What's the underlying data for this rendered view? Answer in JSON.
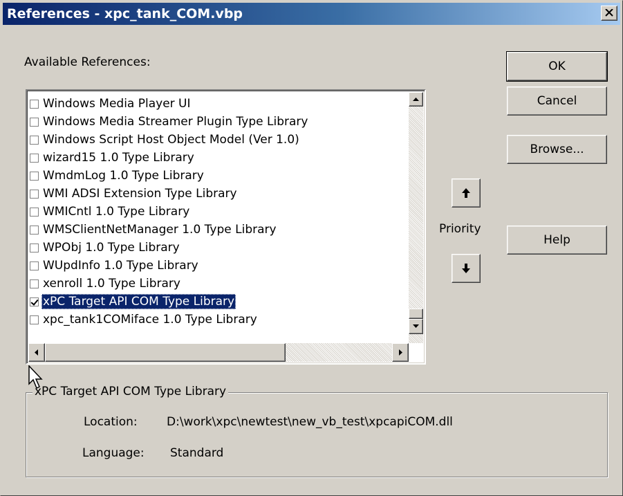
{
  "window": {
    "title": "References - xpc_tank_COM.vbp"
  },
  "available_label": "Available References:",
  "buttons": {
    "ok": "OK",
    "cancel": "Cancel",
    "browse": "Browse...",
    "help": "Help"
  },
  "priority_label": "Priority",
  "references": [
    {
      "label": "Windows Media Player UI",
      "checked": false
    },
    {
      "label": "Windows Media Streamer Plugin Type Library",
      "checked": false
    },
    {
      "label": "Windows Script Host Object Model (Ver 1.0)",
      "checked": false
    },
    {
      "label": "wizard15 1.0 Type Library",
      "checked": false
    },
    {
      "label": "WmdmLog 1.0 Type Library",
      "checked": false
    },
    {
      "label": "WMI ADSI Extension Type Library",
      "checked": false
    },
    {
      "label": "WMICntl 1.0 Type Library",
      "checked": false
    },
    {
      "label": "WMSClientNetManager 1.0 Type Library",
      "checked": false
    },
    {
      "label": "WPObj 1.0 Type Library",
      "checked": false
    },
    {
      "label": "WUpdInfo 1.0 Type Library",
      "checked": false
    },
    {
      "label": "xenroll 1.0 Type Library",
      "checked": false
    },
    {
      "label": "xPC Target API COM Type Library",
      "checked": true,
      "selected": true
    },
    {
      "label": "xpc_tank1COMiface 1.0 Type Library",
      "checked": false
    }
  ],
  "details": {
    "group_title": "xPC Target API COM Type Library",
    "location_label": "Location:",
    "location_value": "D:\\work\\xpc\\newtest\\new_vb_test\\xpcapiCOM.dll",
    "language_label": "Language:",
    "language_value": "Standard"
  },
  "icons": {
    "close": "close-icon",
    "up": "arrow-up-icon",
    "down": "arrow-down-icon",
    "cursor": "mouse-pointer-icon"
  },
  "colors": {
    "title_start": "#0a246a",
    "title_end": "#a6caf0",
    "selection": "#0a246a",
    "dialog_bg": "#d4d0c8"
  }
}
